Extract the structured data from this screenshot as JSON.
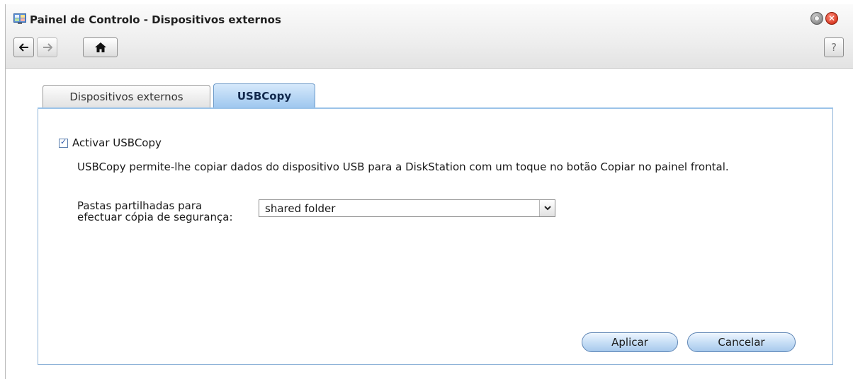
{
  "window": {
    "title": "Painel de Controlo - Dispositivos externos",
    "app_icon": "control-panel-icon",
    "controls": {
      "minimize_icon": "minimize-icon",
      "close_icon": "close-icon",
      "close_glyph": "✕"
    }
  },
  "toolbar": {
    "back_icon": "back-arrow-icon",
    "forward_icon": "forward-arrow-icon",
    "home_icon": "home-icon",
    "help_label": "?"
  },
  "tabs": [
    {
      "label": "Dispositivos externos",
      "active": false
    },
    {
      "label": "USBCopy",
      "active": true
    }
  ],
  "usbcopy": {
    "enable_label": "Activar USBCopy",
    "enable_checked": true,
    "description": "USBCopy permite-lhe copiar dados do dispositivo USB para a DiskStation com um toque no botão Copiar no painel frontal.",
    "folder_label": "Pastas partilhadas para efectuar cópia de segurança:",
    "folder_value": "shared folder"
  },
  "buttons": {
    "apply": "Aplicar",
    "cancel": "Cancelar"
  },
  "colors": {
    "accent": "#9fc8ef",
    "tab_active_text": "#12294d",
    "close_red": "#d93b25"
  }
}
